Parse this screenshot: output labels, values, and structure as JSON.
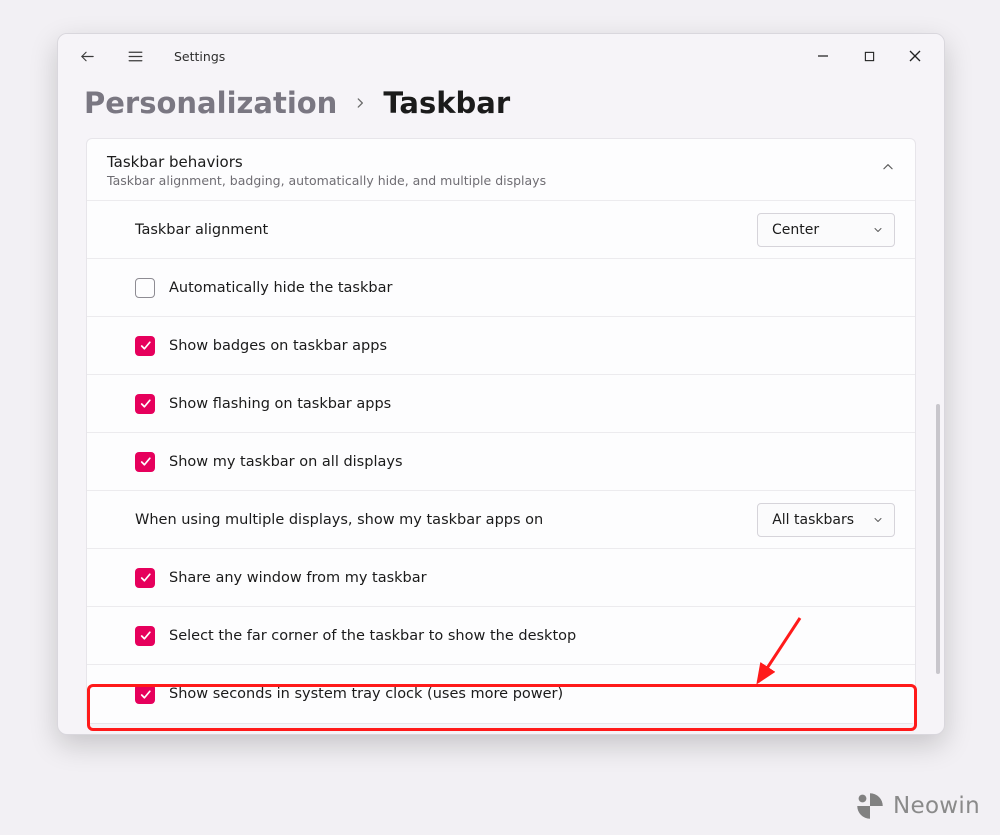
{
  "app": {
    "title": "Settings"
  },
  "breadcrumb": {
    "root": "Personalization",
    "leaf": "Taskbar"
  },
  "panel": {
    "title": "Taskbar behaviors",
    "subtitle": "Taskbar alignment, badging, automatically hide, and multiple displays"
  },
  "rows": {
    "alignment": {
      "label": "Taskbar alignment",
      "value": "Center"
    },
    "autohide": {
      "label": "Automatically hide the taskbar"
    },
    "badges": {
      "label": "Show badges on taskbar apps"
    },
    "flashing": {
      "label": "Show flashing on taskbar apps"
    },
    "alldisp": {
      "label": "Show my taskbar on all displays"
    },
    "multi": {
      "label": "When using multiple displays, show my taskbar apps on",
      "value": "All taskbars"
    },
    "share": {
      "label": "Share any window from my taskbar"
    },
    "corner": {
      "label": "Select the far corner of the taskbar to show the desktop"
    },
    "seconds": {
      "label": "Show seconds in system tray clock (uses more power)"
    }
  },
  "watermark": {
    "text": "Neowin"
  }
}
